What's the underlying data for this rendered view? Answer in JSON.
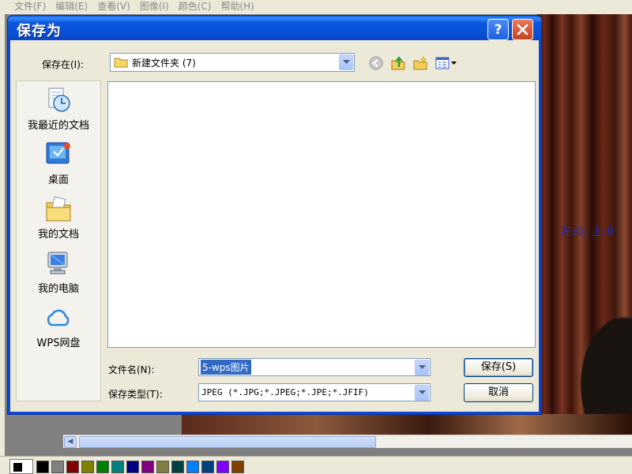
{
  "paint": {
    "menu": [
      "文件(F)",
      "编辑(E)",
      "查看(V)",
      "图像(I)",
      "颜色(C)",
      "帮助(H)"
    ],
    "coord_text": "左:0, 上:0",
    "palette": [
      "#000000",
      "#808080",
      "#800000",
      "#808000",
      "#008000",
      "#008080",
      "#000080",
      "#800080",
      "#808040",
      "#004040",
      "#0080ff",
      "#004080",
      "#8000ff",
      "#804000"
    ]
  },
  "dialog": {
    "title": "保存为",
    "help_label": "?",
    "lookin_label": "保存在(I):",
    "lookin_value": "新建文件夹 (7)",
    "toolbar_icons": [
      "back-icon",
      "up-folder-icon",
      "new-folder-icon",
      "views-menu-icon"
    ],
    "places": [
      {
        "label": "我最近的文档",
        "icon": "recent-documents-icon"
      },
      {
        "label": "桌面",
        "icon": "desktop-icon"
      },
      {
        "label": "我的文档",
        "icon": "my-documents-icon"
      },
      {
        "label": "我的电脑",
        "icon": "my-computer-icon"
      },
      {
        "label": "WPS网盘",
        "icon": "wps-cloud-icon"
      }
    ],
    "filename_label": "文件名(N):",
    "filename_value": "5-wps图片",
    "filetype_label": "保存类型(T):",
    "filetype_value": "JPEG (*.JPG;*.JPEG;*.JPE;*.JFIF)",
    "save_label": "保存(S)",
    "cancel_label": "取消"
  }
}
